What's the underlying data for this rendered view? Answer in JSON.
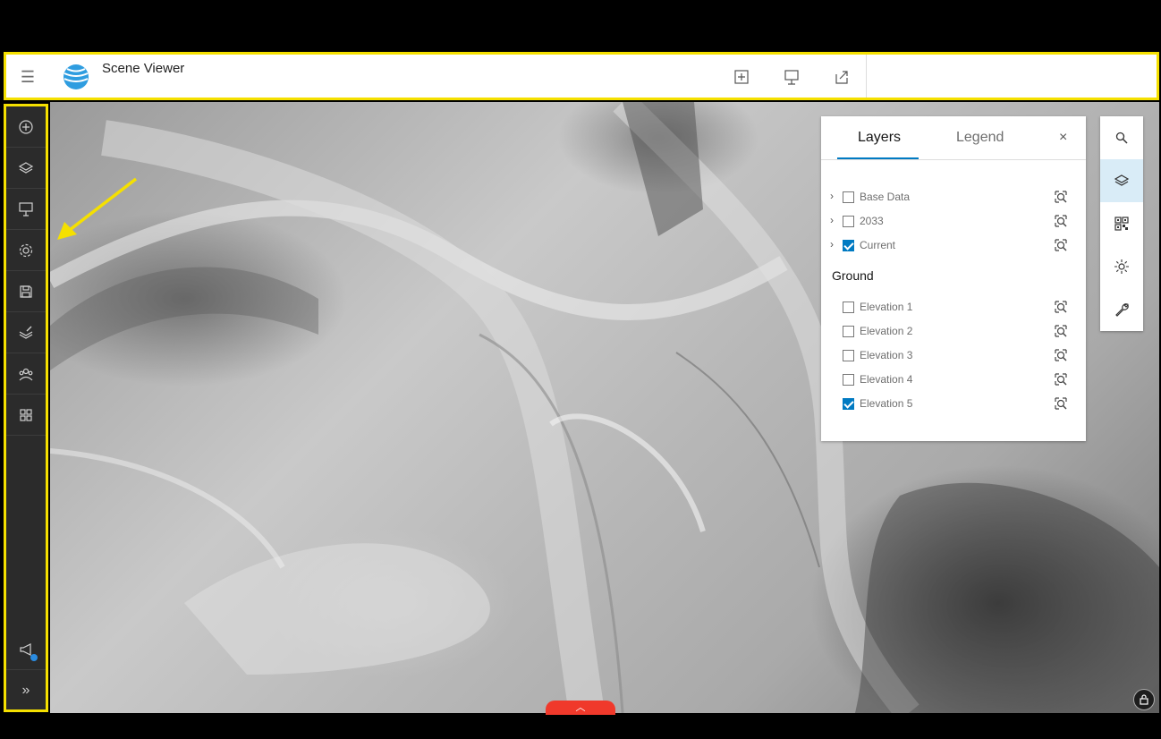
{
  "header": {
    "title": "Scene Viewer",
    "menu_icon": "hamburger-menu-icon",
    "logo_icon": "globe-logo-icon",
    "actions": [
      {
        "icon": "add-square-icon"
      },
      {
        "icon": "presentation-icon"
      },
      {
        "icon": "share-icon"
      }
    ]
  },
  "left_toolbar": {
    "items": [
      {
        "icon": "add-circle-icon"
      },
      {
        "icon": "layers-icon"
      },
      {
        "icon": "presentation-icon"
      },
      {
        "icon": "gear-icon"
      },
      {
        "icon": "save-icon"
      },
      {
        "icon": "edit-layers-icon"
      },
      {
        "icon": "share-group-icon"
      },
      {
        "icon": "grid-icon"
      }
    ],
    "bottom": [
      {
        "icon": "megaphone-icon"
      },
      {
        "icon": "expand-chevrons-icon",
        "glyph": "»"
      }
    ]
  },
  "layers_panel": {
    "tabs": [
      "Layers",
      "Legend"
    ],
    "active_tab": "Layers",
    "close_glyph": "×",
    "operational_layers": [
      {
        "label": "Base Data",
        "checked": false,
        "expandable": true
      },
      {
        "label": "2033",
        "checked": false,
        "expandable": true
      },
      {
        "label": "Current",
        "checked": true,
        "expandable": true
      }
    ],
    "ground_title": "Ground",
    "ground_layers": [
      {
        "label": "Elevation 1",
        "checked": false
      },
      {
        "label": "Elevation 2",
        "checked": false
      },
      {
        "label": "Elevation 3",
        "checked": false
      },
      {
        "label": "Elevation 4",
        "checked": false
      },
      {
        "label": "Elevation 5",
        "checked": true
      }
    ]
  },
  "right_toolbar": {
    "items": [
      {
        "icon": "search-icon",
        "active": false
      },
      {
        "icon": "layers-icon",
        "active": true
      },
      {
        "icon": "qr-basemap-icon",
        "active": false
      },
      {
        "icon": "sun-icon",
        "active": false
      },
      {
        "icon": "wrench-icon",
        "active": false
      }
    ]
  },
  "map": {
    "bottom_toggle_glyph": "︿",
    "lock_icon": "lock-icon"
  },
  "colors": {
    "highlight": "#f5e000",
    "accent": "#007ac2",
    "toggle": "#f0392b"
  }
}
